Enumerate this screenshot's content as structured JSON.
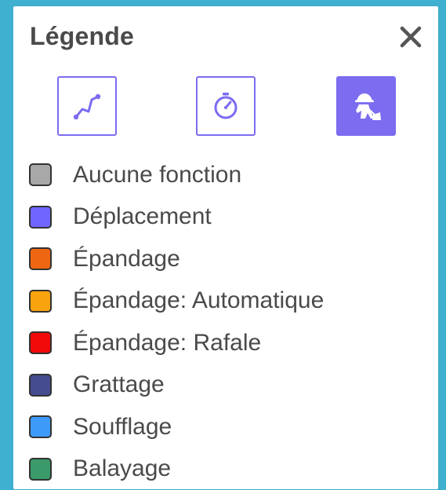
{
  "legend": {
    "title": "Légende",
    "close_icon": "close-icon",
    "tools": [
      {
        "name": "route-tool",
        "icon": "route-icon",
        "active": false
      },
      {
        "name": "time-tool",
        "icon": "stopwatch-icon",
        "active": false
      },
      {
        "name": "work-tool",
        "icon": "worker-shovel-icon",
        "active": true
      }
    ],
    "accent_color": "#7b6cf0",
    "items": [
      {
        "label": "Aucune fonction",
        "color": "#a8a8a8"
      },
      {
        "label": "Déplacement",
        "color": "#6f66ff"
      },
      {
        "label": "Épandage",
        "color": "#ef6612"
      },
      {
        "label": "Épandage: Automatique",
        "color": "#f9a30f"
      },
      {
        "label": "Épandage: Rafale",
        "color": "#f10808"
      },
      {
        "label": "Grattage",
        "color": "#454c8f"
      },
      {
        "label": "Soufflage",
        "color": "#3e9af8"
      },
      {
        "label": "Balayage",
        "color": "#3a9a6a"
      }
    ]
  }
}
